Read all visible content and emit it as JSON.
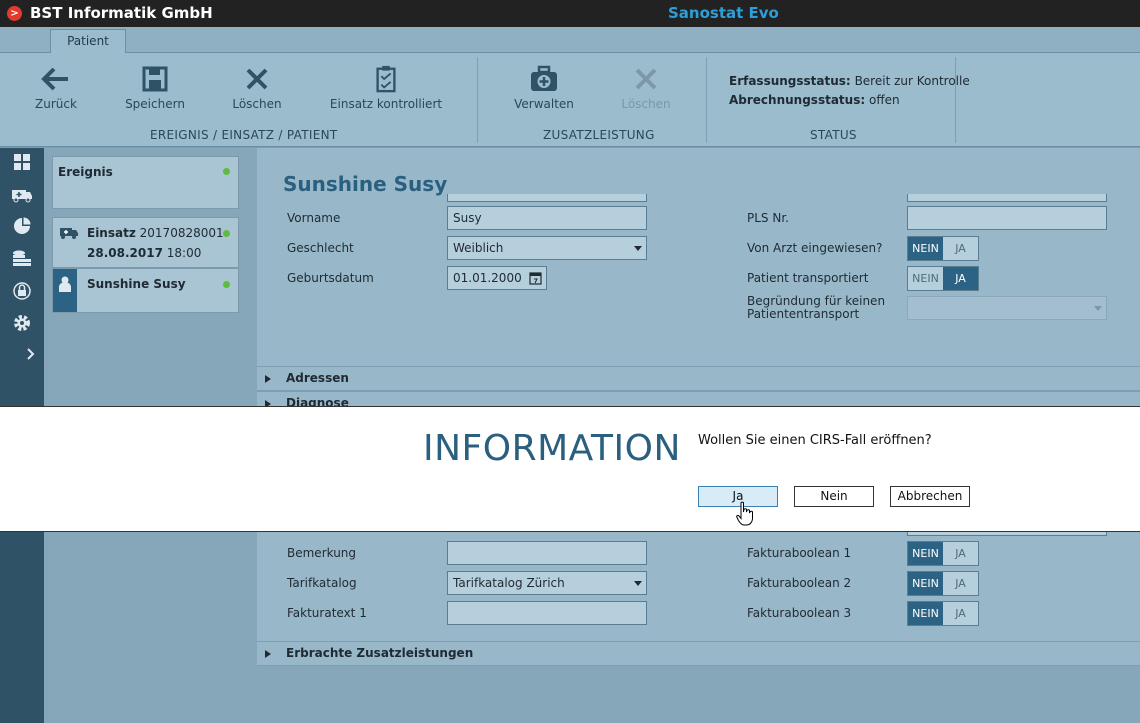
{
  "titlebar": {
    "company": "BST Informatik GmbH",
    "product": "Sanostat Evo"
  },
  "tab": "Patient",
  "ribbon": {
    "buttons": [
      {
        "label": "Zurück",
        "icon": "arrow-left-icon",
        "enabled": true
      },
      {
        "label": "Speichern",
        "icon": "save-icon",
        "enabled": true
      },
      {
        "label": "Löschen",
        "icon": "delete-x-icon",
        "enabled": true
      },
      {
        "label": "Einsatz kontrolliert",
        "icon": "clipboard-check-icon",
        "enabled": true
      },
      {
        "label": "Verwalten",
        "icon": "medical-kit-icon",
        "enabled": true
      },
      {
        "label": "Löschen",
        "icon": "delete-x-icon",
        "enabled": false
      }
    ],
    "groups": [
      "EREIGNIS / EINSATZ / PATIENT",
      "ZUSATZLEISTUNG",
      "STATUS"
    ],
    "status": {
      "erfassung_label": "Erfassungsstatus:",
      "erfassung_value": "Bereit zur Kontrolle",
      "abrechnung_label": "Abrechnungsstatus:",
      "abrechnung_value": "offen"
    }
  },
  "leftnav": [
    "dashboard-icon",
    "ambulance-icon",
    "pie-chart-icon",
    "coins-icon",
    "lock-icon",
    "gear-icon",
    "chevron-right-icon"
  ],
  "tree": {
    "ereignis": "Ereignis",
    "einsatz_label": "Einsatz",
    "einsatz_nr": "20170828001",
    "einsatz_date": "28.08.2017",
    "einsatz_time": "18:00",
    "patient": "Sunshine Susy"
  },
  "form": {
    "patient_name": "Sunshine Susy",
    "vorname_label": "Vorname",
    "vorname_value": "Susy",
    "geschlecht_label": "Geschlecht",
    "geschlecht_value": "Weiblich",
    "geburtsdatum_label": "Geburtsdatum",
    "geburtsdatum_value": "01.01.2000",
    "pls_label": "PLS Nr.",
    "arzt_label": "Von Arzt eingewiesen?",
    "transport_label": "Patient transportiert",
    "begruendung_label_1": "Begründung für keinen",
    "begruendung_label_2": "Patiententransport",
    "toggle_nein": "NEIN",
    "toggle_ja": "JA"
  },
  "sections": [
    "Adressen",
    "Diagnose",
    "Erbrachte Zusatzleistungen"
  ],
  "faktura": {
    "bemerkung_label": "Bemerkung",
    "tarifkatalog_label": "Tarifkatalog",
    "tarifkatalog_value": "Tarifkatalog Zürich",
    "fakturatext_label": "Fakturatext 1",
    "bool1_label": "Fakturaboolean 1",
    "bool2_label": "Fakturaboolean 2",
    "bool3_label": "Fakturaboolean 3"
  },
  "dialog": {
    "title": "INFORMATION",
    "message": "Wollen Sie einen CIRS-Fall eröffnen?",
    "yes": "Ja",
    "no": "Nein",
    "cancel": "Abbrechen"
  }
}
